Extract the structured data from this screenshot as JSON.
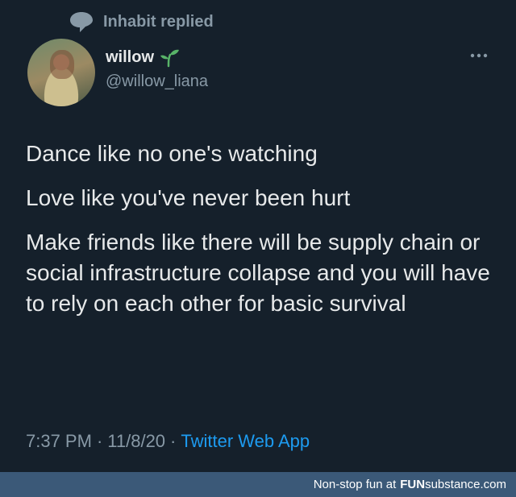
{
  "context": {
    "icon": "speech-bubble-icon",
    "text": "Inhabit replied"
  },
  "author": {
    "display_name": "willow",
    "badge_icon": "sprout-icon",
    "handle": "@willow_liana"
  },
  "tweet": {
    "lines": [
      "Dance like no one's watching",
      "Love like you've never been hurt",
      "Make friends like there will be supply chain or social infrastructure collapse and you will have to rely on each other for basic survival"
    ]
  },
  "meta": {
    "time": "7:37 PM",
    "sep1": "·",
    "date": "11/8/20",
    "sep2": "·",
    "source": "Twitter Web App"
  },
  "footer": {
    "prefix": "Non-stop fun at",
    "brand_part1": "FUN",
    "brand_part2": "substance",
    "brand_part3": ".com"
  },
  "colors": {
    "background": "#15202b",
    "text": "#e7e9ea",
    "secondary": "#8899a6",
    "link": "#1d9bf0",
    "sprout": "#58b368",
    "footer_bg": "#3b5978"
  }
}
